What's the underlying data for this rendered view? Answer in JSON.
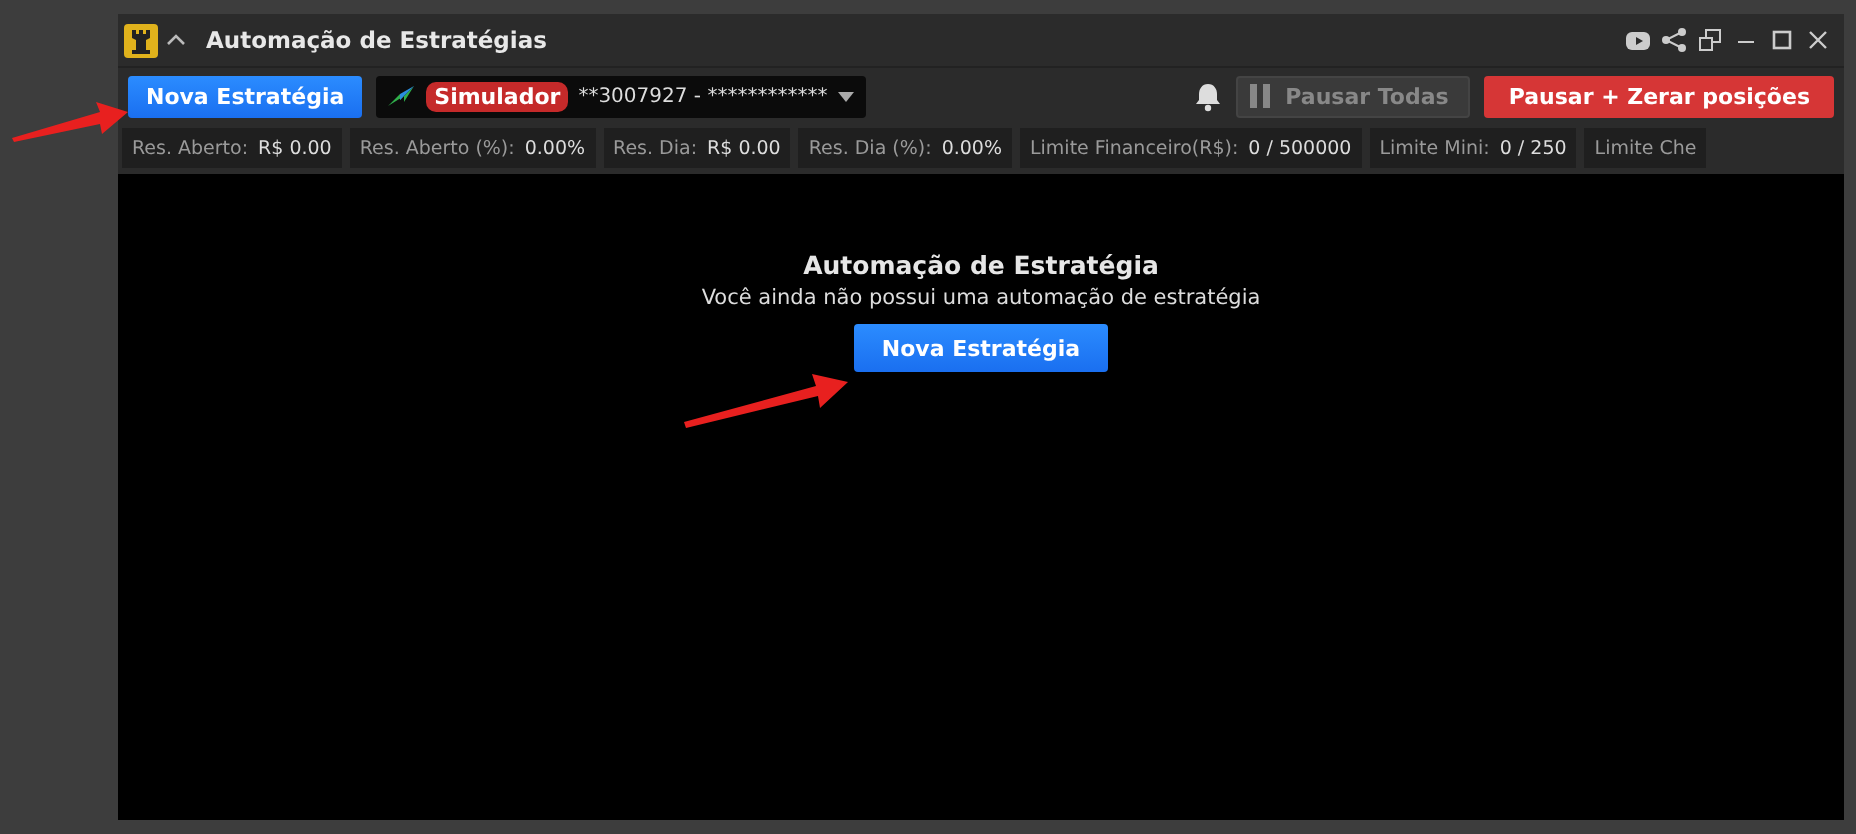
{
  "window": {
    "title": "Automação de Estratégias"
  },
  "toolbar": {
    "new_button": "Nova Estratégia",
    "account": {
      "badge": "Simulador",
      "number": "**3007927 - ************"
    },
    "pause_all": {
      "label": "Pausar Todas",
      "disabled": true
    },
    "pause_reset": "Pausar + Zerar posições"
  },
  "stats": [
    {
      "label": "Res. Aberto:",
      "value": "R$ 0.00"
    },
    {
      "label": "Res. Aberto (%):",
      "value": "0.00%"
    },
    {
      "label": "Res. Dia:",
      "value": "R$ 0.00"
    },
    {
      "label": "Res. Dia (%):",
      "value": "0.00%"
    },
    {
      "label": "Limite Financeiro(R$):",
      "value": "0 / 500000"
    },
    {
      "label": "Limite Mini:",
      "value": "0 / 250"
    },
    {
      "label": "Limite Che"
    }
  ],
  "empty_state": {
    "title": "Automação de Estratégia",
    "message": "Você ainda não possui uma automação de estratégia",
    "button": "Nova Estratégia"
  }
}
